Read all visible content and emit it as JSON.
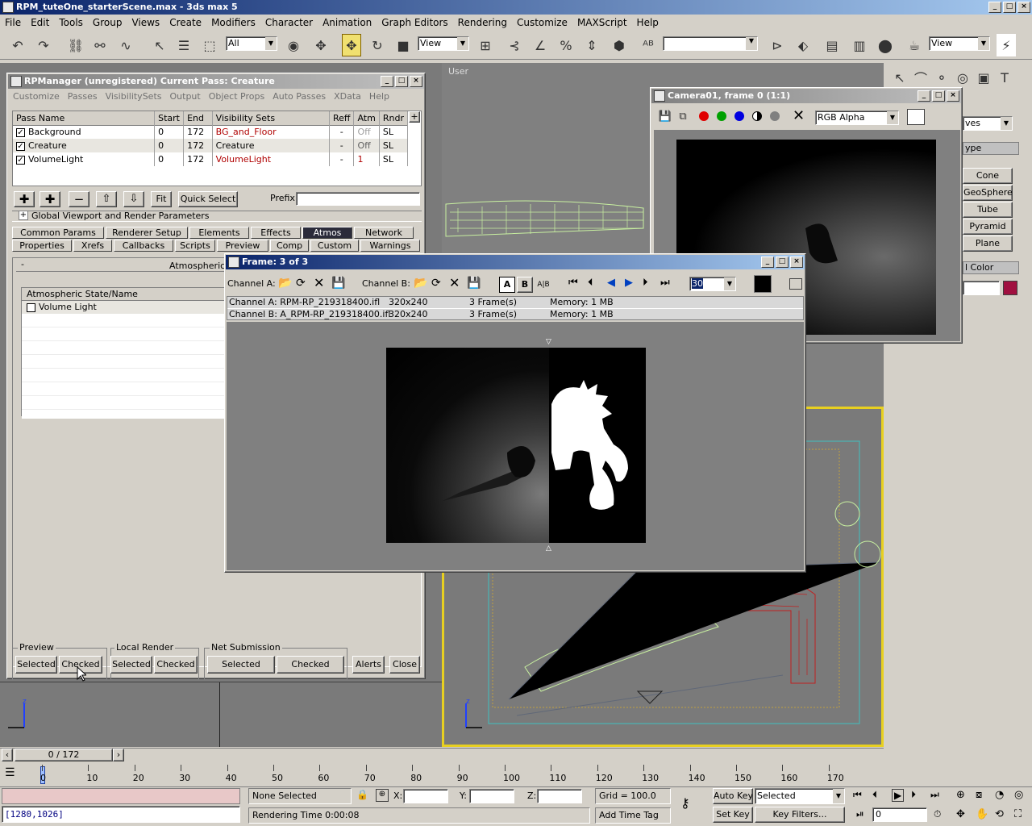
{
  "app": {
    "title": "RPM_tuteOne_starterScene.max - 3ds max 5"
  },
  "menu": [
    "File",
    "Edit",
    "Tools",
    "Group",
    "Views",
    "Create",
    "Modifiers",
    "Character",
    "Animation",
    "Graph Editors",
    "Rendering",
    "Customize",
    "MAXScript",
    "Help"
  ],
  "toolbar": {
    "selection_filter": "All",
    "ref_coord": "View",
    "named_sel": "",
    "view2": "View"
  },
  "viewport_label": "User",
  "rpm": {
    "title": "RPManager (unregistered)   Current Pass: Creature",
    "menu": [
      "Customize",
      "Passes",
      "VisibilitySets",
      "Output",
      "Object Props",
      "Auto Passes",
      "XData",
      "Help"
    ],
    "columns": [
      "Pass Name",
      "Start",
      "End",
      "Visibility Sets",
      "Reff",
      "Atm",
      "Rndr"
    ],
    "rows": [
      {
        "name": "Background",
        "start": "0",
        "end": "172",
        "vis": "BG_and_Floor",
        "reff": "-",
        "atm": "Off",
        "rndr": "SL"
      },
      {
        "name": "Creature",
        "start": "0",
        "end": "172",
        "vis": "Creature",
        "reff": "-",
        "atm": "Off",
        "rndr": "SL"
      },
      {
        "name": "VolumeLight",
        "start": "0",
        "end": "172",
        "vis": "VolumeLight",
        "reff": "-",
        "atm": "1",
        "rndr": "SL"
      }
    ],
    "plus": "+",
    "fit": "Fit",
    "quick_select": "Quick Select",
    "prefix_label": "Prefix:",
    "global_params": "Global Viewport and Render Parameters",
    "tabs_row1": [
      "Common Params",
      "Renderer Setup",
      "Elements",
      "Effects",
      "Atmos",
      "Network"
    ],
    "tabs_row2": [
      "Properties",
      "Xrefs",
      "Callbacks",
      "Scripts",
      "Preview",
      "Comp",
      "Custom",
      "Warnings"
    ],
    "atmos_rollout": "Atmospherics",
    "atmos_col": "Atmospheric State/Name",
    "atmos_item": "Volume Light",
    "preview_label": "Preview",
    "local_render_label": "Local Render",
    "net_label": "Net Submission",
    "selected": "Selected",
    "checked": "Checked",
    "alerts": "Alerts",
    "close": "Close"
  },
  "camera": {
    "title": "Camera01, frame 0 (1:1)",
    "channel": "RGB Alpha"
  },
  "frame": {
    "title": "Frame: 3 of 3",
    "channel_a": "Channel A:",
    "channel_b": "Channel B:",
    "zoom": "30",
    "a_label": "A",
    "b_label": "B",
    "ab_label": "A|B",
    "info": [
      {
        "ch": "Channel A: RPM-RP_219318400.ifl",
        "res": "320x240",
        "frames": "3 Frame(s)",
        "mem": "Memory: 1 MB"
      },
      {
        "ch": "Channel B: A_RPM-RP_219318400.ifl",
        "res": "320x240",
        "frames": "3 Frame(s)",
        "mem": "Memory: 1 MB"
      }
    ]
  },
  "cmdpanel": {
    "dropdown": "ves",
    "ype": "ype",
    "buttons": [
      "Cone",
      "GeoSphere",
      "Tube",
      "Pyramid",
      "Plane"
    ],
    "color": "l Color"
  },
  "timeslider": {
    "label": "0 / 172"
  },
  "ruler": [
    "0",
    "10",
    "20",
    "30",
    "40",
    "50",
    "60",
    "70",
    "80",
    "90",
    "100",
    "110",
    "120",
    "130",
    "140",
    "150",
    "160",
    "170"
  ],
  "status": {
    "coords": "[1280,1026]",
    "none_selected": "None Selected",
    "x": "X:",
    "y": "Y:",
    "z": "Z:",
    "grid": "Grid = 100.0",
    "auto_key": "Auto Key",
    "selected": "Selected",
    "set_key": "Set Key",
    "key_filters": "Key Filters...",
    "rendering_time": "Rendering Time  0:00:08",
    "add_time_tag": "Add Time Tag",
    "frame": "0"
  }
}
